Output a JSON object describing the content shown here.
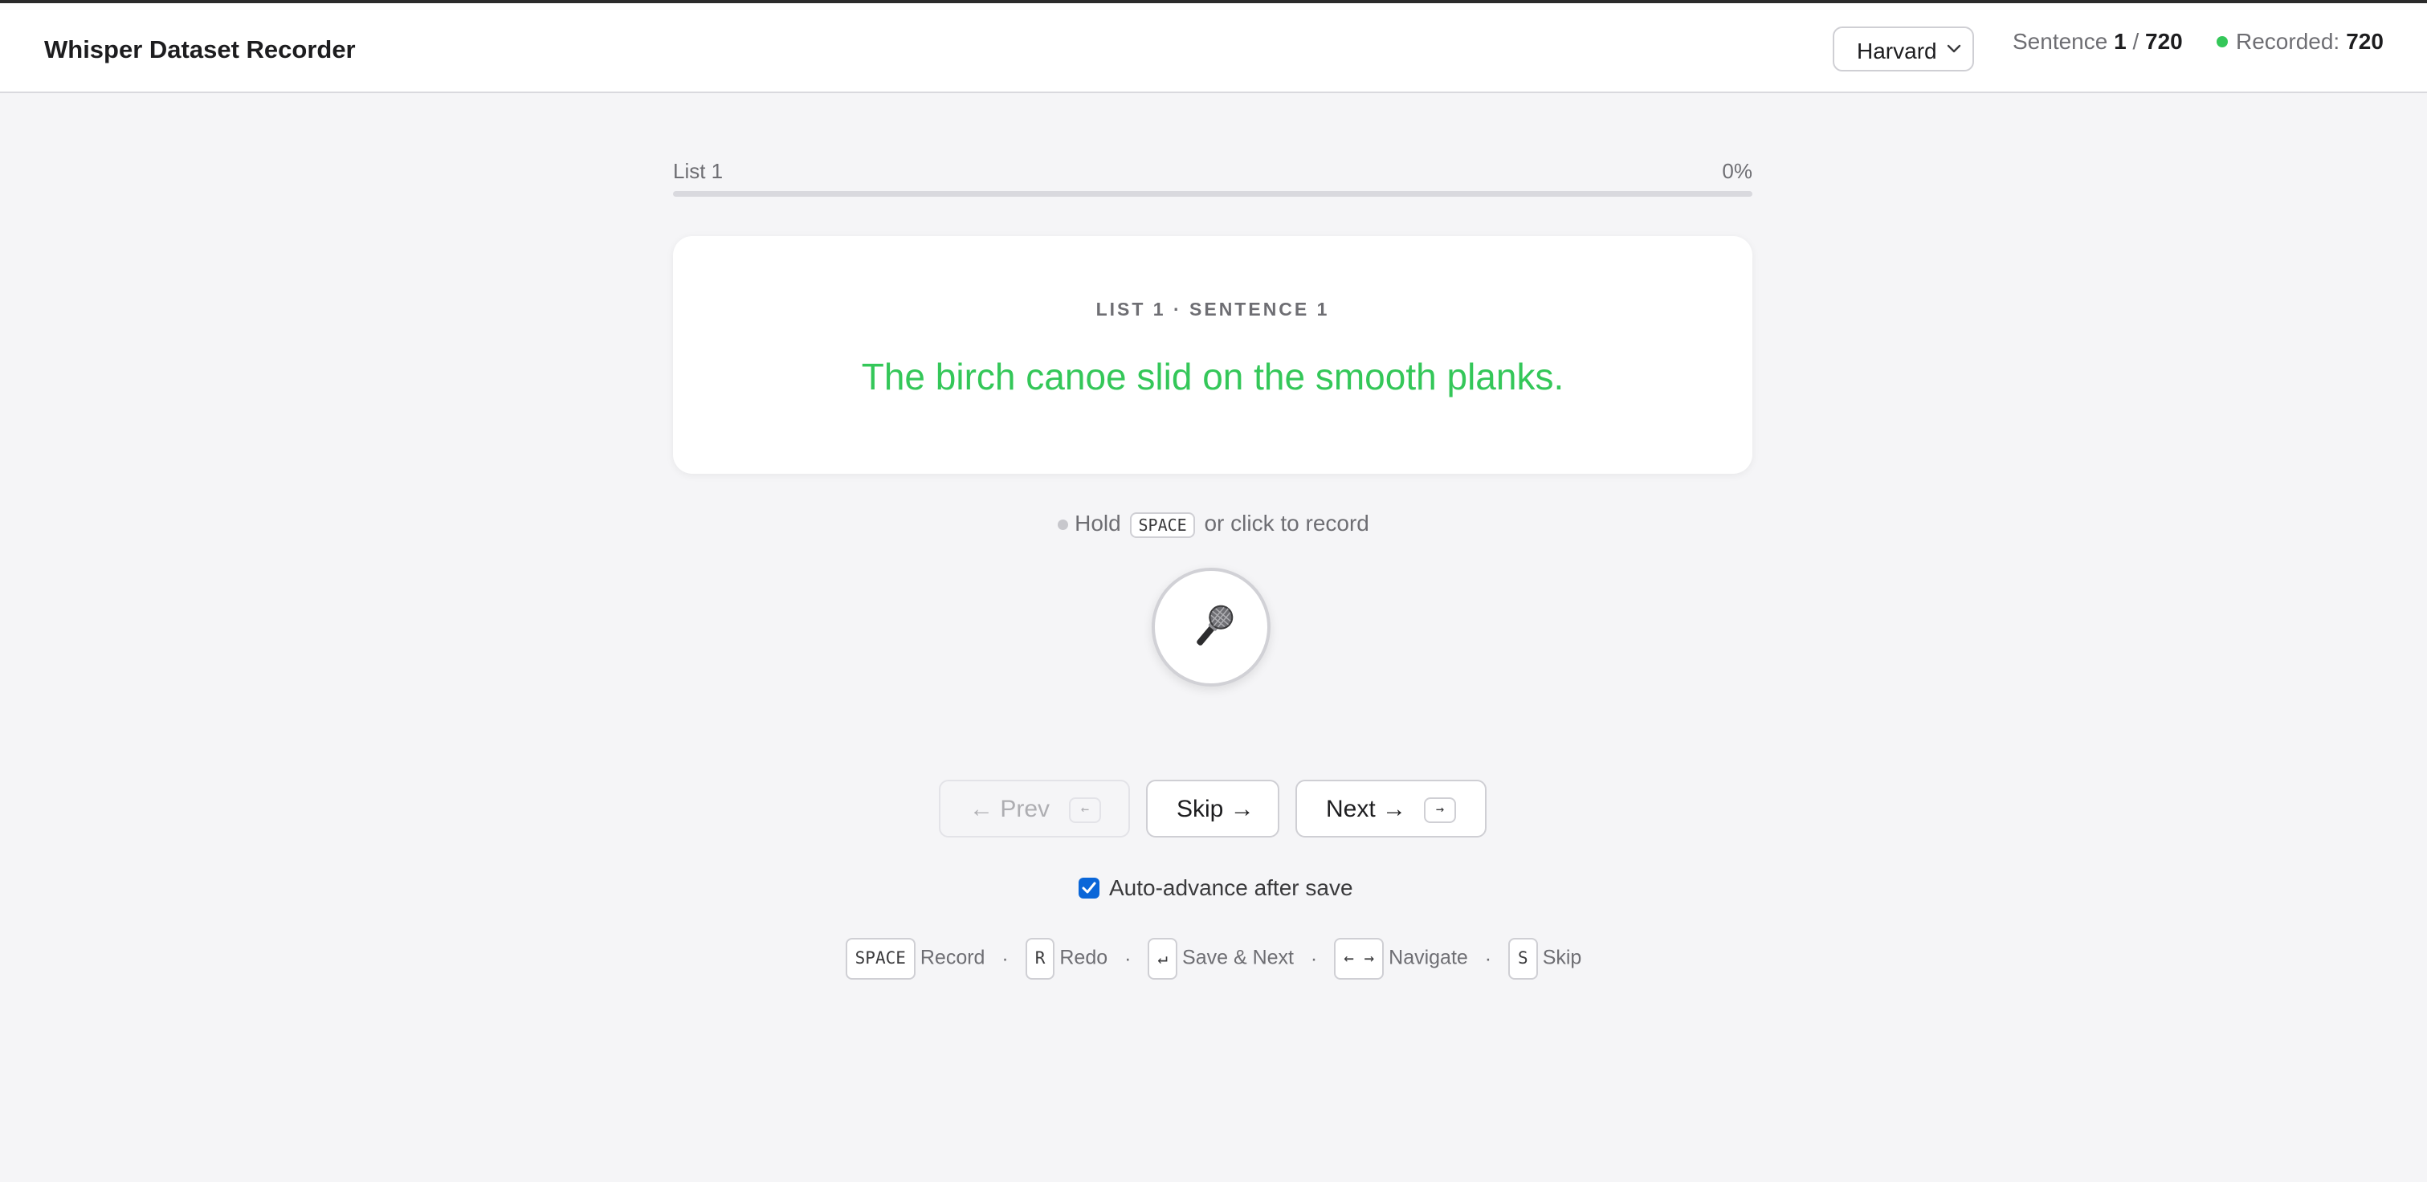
{
  "header": {
    "title": "Whisper Dataset Recorder",
    "dataset_select": {
      "selected": "Harvard",
      "icon": "chevron-down-icon"
    },
    "sentence_counter": {
      "prefix": "Sentence",
      "current": "1",
      "separator": "/",
      "total": "720"
    },
    "recorded_counter": {
      "label": "Recorded:",
      "value": "720",
      "dot_color": "#34c759"
    }
  },
  "progress": {
    "label": "List 1",
    "percent_text": "0%",
    "fraction": 0
  },
  "card": {
    "label": "LIST 1 · SENTENCE 1",
    "sentence": "The birch canoe slid on the smooth planks.",
    "sentence_color": "#34c759"
  },
  "record": {
    "hint_before": "Hold",
    "hint_key": "SPACE",
    "hint_after": "or click to record",
    "icon": "microphone-icon"
  },
  "nav": {
    "prev_label": "← Prev",
    "prev_key": "←",
    "skip_label": "Skip →",
    "next_label": "Next →",
    "next_key": "→"
  },
  "auto_advance": {
    "label": "Auto-advance after save",
    "checked": true
  },
  "shortcuts": [
    {
      "key": "SPACE",
      "label": "Record"
    },
    {
      "key": "R",
      "label": "Redo"
    },
    {
      "key": "↵",
      "label": "Save & Next"
    },
    {
      "key": "← →",
      "label": "Navigate"
    },
    {
      "key": "S",
      "label": "Skip"
    }
  ],
  "shortcut_separator": "·",
  "colors": {
    "accent_green": "#34c759",
    "checkbox_blue": "#0a66d8",
    "background": "#f5f5f7"
  }
}
